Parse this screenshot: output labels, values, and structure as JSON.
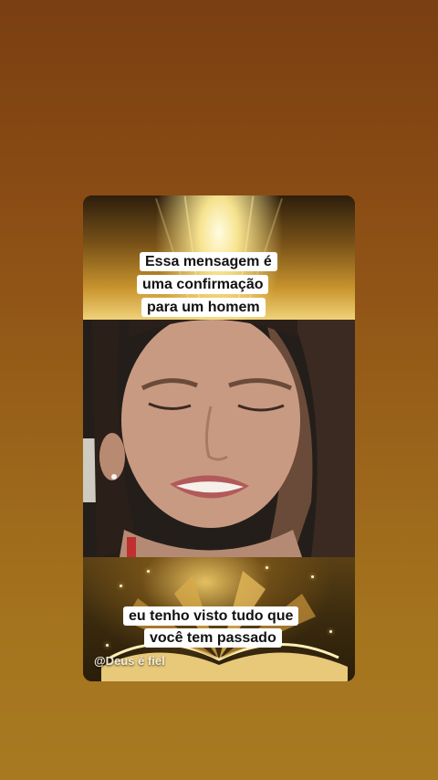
{
  "captions": {
    "top": [
      "Essa mensagem é",
      "uma confirmação",
      "para um homem"
    ],
    "bottom": [
      "eu tenho visto tudo que",
      "você tem passado"
    ]
  },
  "watermark": "@Deus é fiel",
  "colors": {
    "background_top": "#7a3f12",
    "background_bottom": "#a77a22",
    "caption_bg": "#ffffff",
    "caption_text": "#111111"
  },
  "icons": [
    "light-burst-image",
    "open-book-image",
    "person-video-frame"
  ]
}
